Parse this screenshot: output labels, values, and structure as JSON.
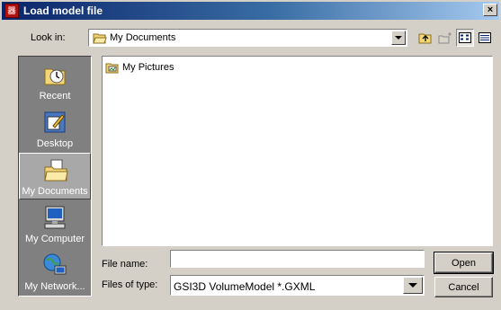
{
  "window": {
    "title": "Load model file",
    "close_glyph": "×"
  },
  "lookin": {
    "label": "Look in:",
    "value": "My Documents"
  },
  "toolbar": {
    "icons": [
      "up-folder-icon",
      "new-folder-icon",
      "list-view-icon",
      "details-view-icon"
    ]
  },
  "places": [
    {
      "label": "Recent",
      "icon": "recent-icon"
    },
    {
      "label": "Desktop",
      "icon": "desktop-icon"
    },
    {
      "label": "My Documents",
      "icon": "my-documents-icon",
      "selected": true
    },
    {
      "label": "My Computer",
      "icon": "my-computer-icon"
    },
    {
      "label": "My Network...",
      "icon": "my-network-icon"
    }
  ],
  "files": [
    {
      "name": "My Pictures",
      "icon": "picture-folder-icon"
    }
  ],
  "filename": {
    "label": "File name:",
    "value": ""
  },
  "filetype": {
    "label": "Files of type:",
    "value": "GSI3D VolumeModel *.GXML"
  },
  "buttons": {
    "open": "Open",
    "cancel": "Cancel"
  }
}
